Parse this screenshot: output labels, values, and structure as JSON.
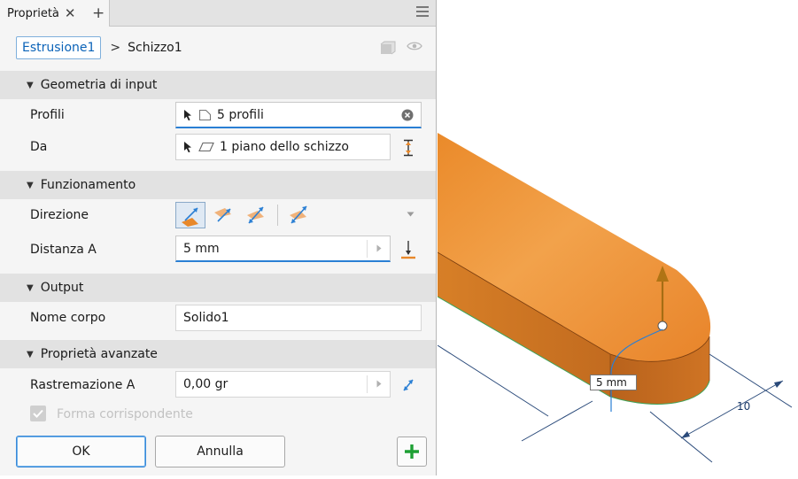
{
  "tab": {
    "title": "Proprietà"
  },
  "breadcrumb": {
    "root": "Estrusione1",
    "separator": ">",
    "current": "Schizzo1"
  },
  "sections": {
    "input": "Geometria di input",
    "behavior": "Funzionamento",
    "output": "Output",
    "advanced": "Proprietà avanzate"
  },
  "fields": {
    "profiles": {
      "label": "Profili",
      "value": "5 profili"
    },
    "from": {
      "label": "Da",
      "value": "1 piano dello schizzo"
    },
    "direction": {
      "label": "Direzione"
    },
    "distance": {
      "label": "Distanza A",
      "value": "5 mm"
    },
    "body_name": {
      "label": "Nome corpo",
      "value": "Solido1"
    },
    "taper": {
      "label": "Rastremazione A",
      "value": "0,00 gr"
    },
    "match_shape": {
      "label": "Forma corrispondente"
    }
  },
  "buttons": {
    "ok": "OK",
    "cancel": "Annulla"
  },
  "viewport": {
    "distance_tag": "5 mm",
    "dimension": "10"
  },
  "colors": {
    "accent": "#2a7fd4",
    "extrude_orange": "#e8882a",
    "plus_green": "#1ea034"
  }
}
